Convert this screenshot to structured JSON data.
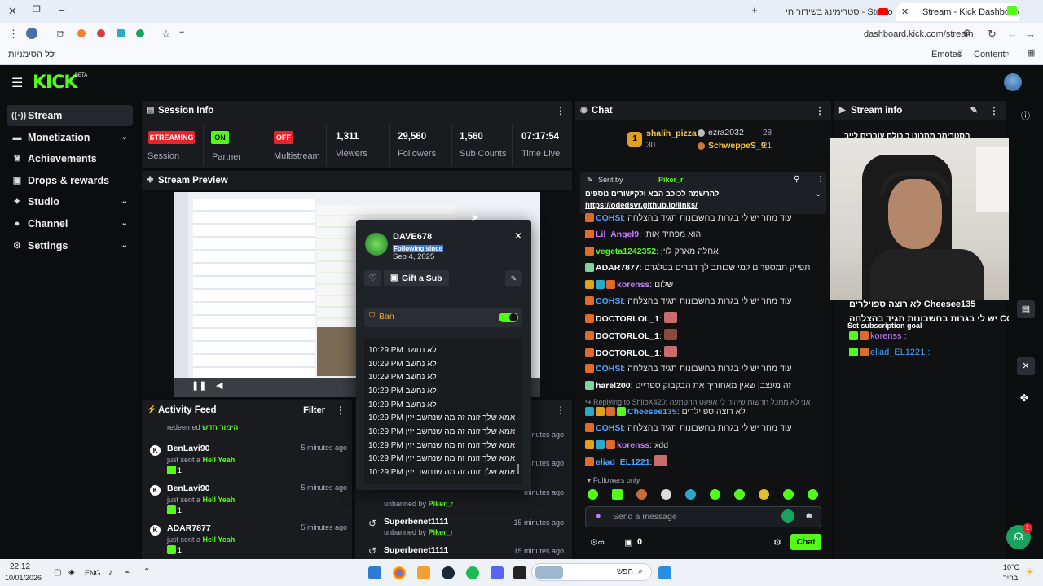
{
  "browser": {
    "tabs": [
      {
        "label": "סטרימינג בשידור חי - Studio",
        "active": false
      },
      {
        "label": "Stream - Kick Dashboard",
        "active": true
      }
    ],
    "url": "dashboard.kick.com/stream",
    "bookmarks_all": "כל הסימניות",
    "emotes": "Emotes",
    "content": "Content"
  },
  "app": {
    "logo": "KICK",
    "logo_beta": "BETA",
    "accent": "#53fc18"
  },
  "sidebar": {
    "items": [
      {
        "label": "Stream",
        "icon": "broadcast-icon",
        "expandable": false,
        "active": true
      },
      {
        "label": "Monetization",
        "icon": "money-icon",
        "expandable": true
      },
      {
        "label": "Achievements",
        "icon": "trophy-icon",
        "expandable": false
      },
      {
        "label": "Drops & rewards",
        "icon": "gift-icon",
        "expandable": false
      },
      {
        "label": "Studio",
        "icon": "studio-icon",
        "expandable": true
      },
      {
        "label": "Channel",
        "icon": "channel-icon",
        "expandable": true
      },
      {
        "label": "Settings",
        "icon": "gear-icon",
        "expandable": true
      }
    ]
  },
  "session": {
    "title": "Session Info",
    "streaming_badge": "STREAMING",
    "session_label": "Session",
    "partner_badge": "ON",
    "partner_label": "Partner Income",
    "multistream_badge": "OFF",
    "multistream_label": "Multistream",
    "viewers_value": "1,311",
    "viewers_label": "Viewers",
    "followers_value": "29,560",
    "followers_label": "Followers",
    "subs_value": "1,560",
    "subs_label": "Sub Counts",
    "time_value": "07:17:54",
    "time_label": "Time Live"
  },
  "preview": {
    "title": "Stream Preview"
  },
  "modal": {
    "username": "DAVE678",
    "following_since_label": "Following since",
    "following_date": "Sep 4, 2025",
    "gift_sub": "Gift a Sub",
    "ban_label": "Ban",
    "messages": [
      {
        "time": "10:29 PM",
        "text": "לא נחשב"
      },
      {
        "time": "10:29 PM",
        "text": "לא נחשב"
      },
      {
        "time": "10:29 PM",
        "text": "לא נחשב"
      },
      {
        "time": "10:29 PM",
        "text": "לא נחשב"
      },
      {
        "time": "10:29 PM",
        "text": "לא נחשב"
      },
      {
        "time": "10:29 PM",
        "text": "אמא שלך זונה זה מה שנחשב יזין"
      },
      {
        "time": "10:29 PM",
        "text": "אמא שלך זונה זה מה שנחשב יזין"
      },
      {
        "time": "10:29 PM",
        "text": "אמא שלך זונה זה מה שנחשב יזין"
      },
      {
        "time": "10:29 PM",
        "text": "אמא שלך זונה זה מה שנחשב יזין"
      },
      {
        "time": "10:29 PM",
        "text": "אמא שלך זונה זה מה שנחשב יזין"
      }
    ]
  },
  "activity": {
    "title": "Activity Feed",
    "filter": "Filter",
    "top_line_action": "redeemed",
    "top_line_reward": "הימור חדש",
    "rows": [
      {
        "name": "BenLavi90",
        "time": "5 minutes ago",
        "action": "just sent a",
        "item": "Hell Yeah",
        "count": "1"
      },
      {
        "name": "BenLavi90",
        "time": "5 minutes ago",
        "action": "just sent a",
        "item": "Hell Yeah",
        "count": "1"
      },
      {
        "name": "ADAR7877",
        "time": "5 minutes ago",
        "action": "just sent a",
        "item": "Hell Yeah",
        "count": "1"
      }
    ]
  },
  "modlog": {
    "times": [
      "minutes ago",
      "minutes ago",
      "minutes ago"
    ],
    "rows": [
      {
        "action": "unbanned by",
        "by": "Piker_r"
      },
      {
        "name": "Superbenet1111",
        "time": "15 minutes ago",
        "action": "unbanned by",
        "by": "Piker_r"
      },
      {
        "name": "Superbenet1111",
        "time": "15 minutes ago"
      }
    ]
  },
  "chat": {
    "title": "Chat",
    "leader_1_name": "shalih_pizza",
    "leader_1_rank": "1",
    "leader_1_count": "30",
    "leader_2_name": "ezra2032",
    "leader_2_count": "28",
    "leader_3_name": "SchweppeS_9",
    "leader_3_count": "21",
    "pinned_by_label": "Sent by",
    "pinned_by": "Piker_r",
    "pinned_text": "להרשמה לכוכב הבא ולקישורים נוספים",
    "pinned_link": "https://odedsvr.github.io/links/",
    "lines": [
      {
        "user": "COHSI",
        "color": "#4aa3ff",
        "text": "עוד מחר יש לי בגרות בחשבונות תגיד בהצלחה"
      },
      {
        "user": "Lil_Angel9",
        "color": "#c77dff",
        "text": "הוא מפחיד אותי"
      },
      {
        "user": "vegeta1242352",
        "color": "#53fc18",
        "text": "אחלה מארק לוין"
      },
      {
        "user": "ADAR7877",
        "color": "#ffffff",
        "text": "תפייק תמספרים למי שכותב לך דברים בטלגרם"
      },
      {
        "user": "korenss",
        "color": "#c77dff",
        "text": "שלום"
      },
      {
        "user": "COHSI",
        "color": "#4aa3ff",
        "text": "עוד מחר יש לי בגרות בחשבונות תגיד בהצלחה"
      },
      {
        "user": "DOCTORLOL_1",
        "color": "#ffffff",
        "text": ""
      },
      {
        "user": "DOCTORLOL_1",
        "color": "#ffffff",
        "text": ""
      },
      {
        "user": "DOCTORLOL_1",
        "color": "#ffffff",
        "text": ""
      },
      {
        "user": "COHSI",
        "color": "#4aa3ff",
        "text": "עוד מחר יש לי בגרות בחשבונות תגיד בהצלחה"
      },
      {
        "user": "harel200",
        "color": "#ffffff",
        "text": "זה מעצבן שאין מאחוריך את הבקבוק ספרייט"
      }
    ],
    "reply_label": "Replying to ShiloX420:",
    "reply_text": "אני לא מתכל חדשות שיהיה לי אפקט ההפתעה",
    "lines2": [
      {
        "user": "Cheesee135",
        "color": "#4aa3ff",
        "text": "לא רוצה ספוילרים"
      },
      {
        "user": "COHSI",
        "color": "#4aa3ff",
        "text": "עוד מחר יש לי בגרות בחשבונות תגיד בהצלחה"
      },
      {
        "user": "korenss",
        "color": "#c77dff",
        "text": "xdd"
      },
      {
        "user": "eliad_EL1221",
        "color": "#4aa3ff",
        "text": ""
      }
    ],
    "mode": "Followers only",
    "placeholder": "Send a message",
    "viewer_count": "0",
    "send": "Chat"
  },
  "stream_info": {
    "title": "Stream info",
    "top_text": "הסטרימר מתכונן כ כולם עוברים לייב",
    "overlay_1": "לא רוצה ספוילרים Cheesee135",
    "overlay_2": "יש לי בגרות בחשבונות תגיד בהצלחה COHSI",
    "overlay_goal": "Set subscription goal",
    "overlay_3": "korenss",
    "overlay_4": "ellad_EL1221"
  },
  "taskbar": {
    "time": "22:12",
    "date": "10/01/2026",
    "lang": "ENG",
    "search": "חפש",
    "weather_temp": "10°C",
    "weather_desc": "בהיר"
  },
  "help_badge": "1"
}
